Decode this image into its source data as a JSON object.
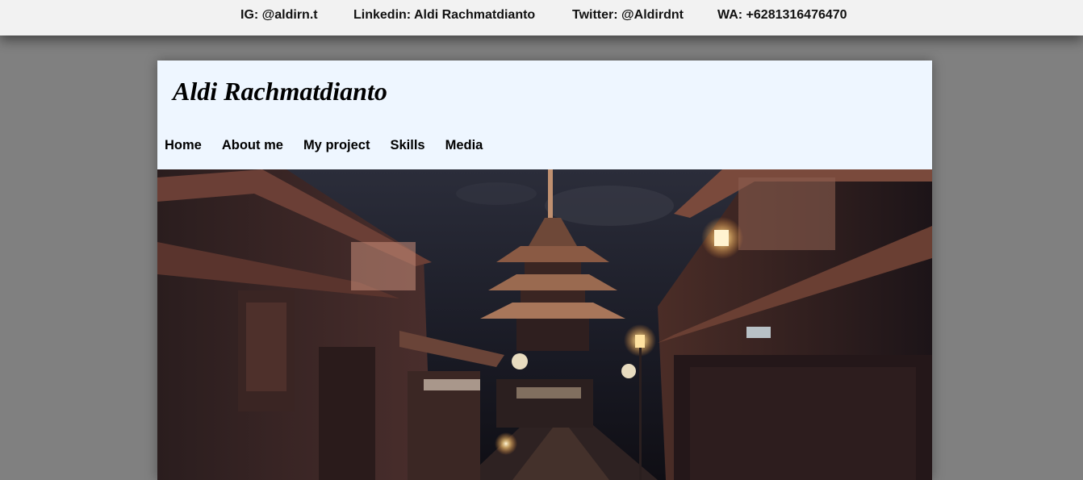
{
  "contacts": [
    {
      "label": "IG: @aldirn.t"
    },
    {
      "label": "Linkedin: Aldi Rachmatdianto"
    },
    {
      "label": "Twitter: @Aldirdnt"
    },
    {
      "label": "WA: +6281316476470"
    }
  ],
  "site": {
    "title": "Aldi Rachmatdianto"
  },
  "nav": {
    "items": [
      {
        "label": "Home"
      },
      {
        "label": "About me"
      },
      {
        "label": "My project"
      },
      {
        "label": "Skills"
      },
      {
        "label": "Media"
      }
    ]
  },
  "hero": {
    "image_name": "kyoto-night-street-pagoda-photo"
  },
  "colors": {
    "page_background": "#808080",
    "contact_bar": "#f2f2f2",
    "card_background": "#eef6ff"
  }
}
